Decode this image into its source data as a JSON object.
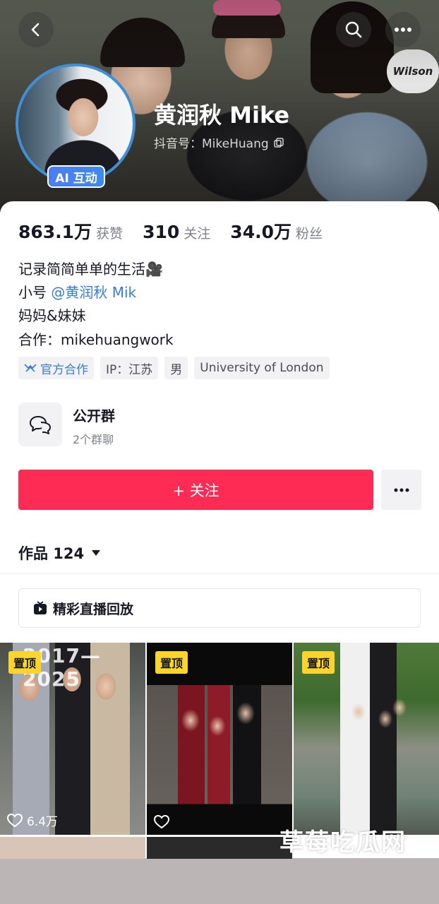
{
  "profile": {
    "name": "黄润秋 Mike",
    "douyin_id": "抖音号：MikeHuang",
    "ai_badge": "AI 互动"
  },
  "stats": {
    "likes_value": "863.1万",
    "likes_label": "获赞",
    "following_value": "310",
    "following_label": "关注",
    "followers_value": "34.0万",
    "followers_label": "粉丝"
  },
  "bio": {
    "line1": "记录简简单单的生活🎥",
    "line2_prefix": "小号 ",
    "line2_mention": "@黄润秋 Mik",
    "line3": "妈妈&妹妹",
    "line4": "合作：mikehuangwork"
  },
  "tags": [
    "官方合作",
    "IP：江苏",
    "男",
    "University of London"
  ],
  "group": {
    "title": "公开群",
    "subtitle": "2个群聊"
  },
  "actions": {
    "follow_label": "+ 关注"
  },
  "works": {
    "label": "作品 124"
  },
  "replay": {
    "label": "精彩直播回放"
  },
  "videos": [
    {
      "pinned": "置顶",
      "likes": "6.4万",
      "overlay": "2017—2025"
    },
    {
      "pinned": "置顶",
      "likes": ""
    },
    {
      "pinned": "置顶",
      "likes": ""
    }
  ],
  "watermark": "草莓吃瓜网",
  "colors": {
    "follow": "#fe2c55",
    "pinned": "#fcd52c",
    "avatar_ring": "#3f8fd6",
    "link": "#3a7bd5"
  }
}
